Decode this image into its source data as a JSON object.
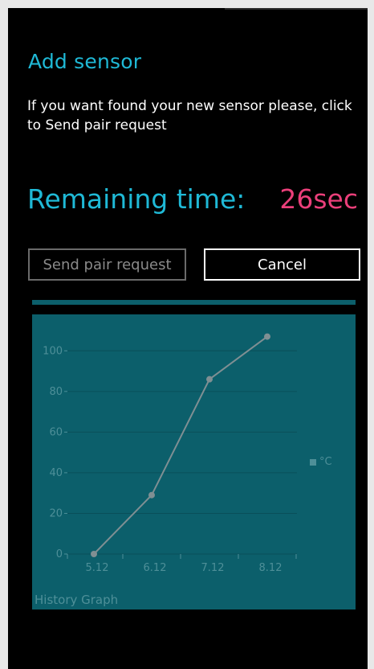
{
  "page": {
    "title": "Add sensor",
    "description": "If you want found your new sensor please, click to Send pair request",
    "remaining_label": "Remaining time:",
    "remaining_value": "26sec"
  },
  "buttons": {
    "pair_label": "Send pair request",
    "cancel_label": "Cancel"
  },
  "chart_caption": "History Graph",
  "colors": {
    "accent": "#1fb9d6",
    "time_value": "#ea3f7a",
    "chart_background": "#0c5f6b",
    "chart_muted": "#4e8f98",
    "series_line": "#7f8f93"
  },
  "chart_data": {
    "type": "line",
    "categories": [
      "5.12",
      "6.12",
      "7.12",
      "8.12"
    ],
    "x_ticks": [
      "5.12",
      "6.12",
      "7.12",
      "8.12"
    ],
    "series": [
      {
        "name": "°C",
        "values": [
          0,
          29,
          86,
          107
        ]
      }
    ],
    "y_ticks": [
      0,
      20,
      40,
      60,
      80,
      100
    ],
    "ylim": [
      0,
      110
    ],
    "grid": true,
    "legend": "right"
  }
}
